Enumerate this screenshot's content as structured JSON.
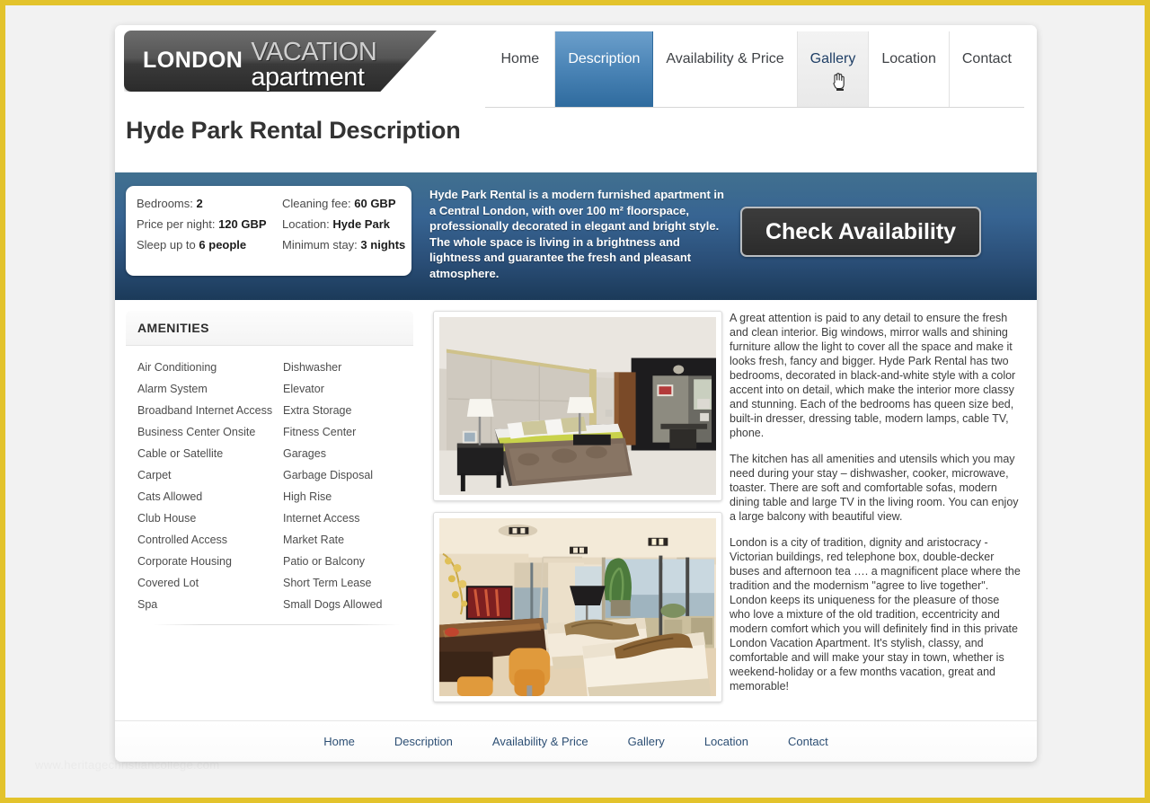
{
  "site": {
    "logo_primary": "LONDON",
    "logo_secondary": "VACATION",
    "logo_tertiary": "apartment"
  },
  "nav": {
    "items": [
      {
        "label": "Home",
        "state": "default"
      },
      {
        "label": "Description",
        "state": "active"
      },
      {
        "label": "Availability & Price",
        "state": "default"
      },
      {
        "label": "Gallery",
        "state": "hover"
      },
      {
        "label": "Location",
        "state": "default"
      },
      {
        "label": "Contact",
        "state": "default"
      }
    ]
  },
  "page": {
    "title": "Hyde Park Rental Description"
  },
  "facts": [
    {
      "label": "Bedrooms:",
      "value": "2"
    },
    {
      "label": "Cleaning fee:",
      "value": "60 GBP"
    },
    {
      "label": "Price per night:",
      "value": "120 GBP"
    },
    {
      "label": "Location:",
      "value": "Hyde Park"
    },
    {
      "label": "Sleep up to",
      "value": "6 people"
    },
    {
      "label": "Minimum stay:",
      "value": "3 nights"
    }
  ],
  "band": {
    "summary": "Hyde Park Rental is a modern furnished apartment in a Central London, with over 100 m² floorspace, professionally decorated in elegant and bright style. The whole space is living in a brightness and lightness and guarantee the fresh and pleasant atmosphere.",
    "cta_label": "Check Availability"
  },
  "amenities": {
    "heading": "AMENITIES",
    "left": [
      "Air Conditioning",
      "Alarm System",
      "Broadband Internet Access",
      "Business Center Onsite",
      "Cable or Satellite",
      "Carpet",
      "Cats Allowed",
      "Club House",
      "Controlled Access",
      "Corporate Housing",
      "Covered Lot",
      "Spa"
    ],
    "right": [
      "Dishwasher",
      "Elevator",
      "Extra Storage",
      "Fitness Center",
      "Garages",
      "Garbage Disposal",
      "High Rise",
      "Internet Access",
      "Market Rate",
      "Patio or Balcony",
      "Short Term Lease",
      "Small Dogs Allowed"
    ]
  },
  "photos": [
    {
      "alt": "bedroom-photo"
    },
    {
      "alt": "living-room-photo"
    }
  ],
  "description": {
    "paragraphs": [
      "A great attention is paid to any detail to ensure the fresh and clean interior. Big windows, mirror walls and shining furniture allow the light to cover all the space and make it looks fresh, fancy and bigger. Hyde Park Rental has two bedrooms, decorated in black-and-white style with a color accent into on detail, which make the interior more classy and stunning. Each of the bedrooms has queen size bed, built-in dresser, dressing table, modern lamps, cable TV, phone.",
      "The kitchen has all amenities and utensils which you may need during your stay – dishwasher, cooker, microwave, toaster. There are soft and comfortable sofas, modern dining table and large TV in the living room. You can enjoy a large balcony with beautiful view.",
      "London is a city of tradition, dignity and aristocracy - Victorian buildings, red telephone box, double-decker buses and afternoon tea …. a magnificent place where the tradition and the modernism \"agree to live together\". London keeps its uniqueness for the pleasure of those who love a mixture of the old tradition, eccentricity and modern comfort which you will definitely find in this private London Vacation Apartment. It's stylish, classy, and comfortable and will make your stay in town, whether is weekend-holiday or a few months vacation, great and memorable!"
    ]
  },
  "footer": {
    "links": [
      "Home",
      "Description",
      "Availability & Price",
      "Gallery",
      "Location",
      "Contact"
    ]
  },
  "watermark": "www.heritagechristiancollege.com",
  "colors": {
    "page_border": "#e3c32c",
    "nav_active": "#2f6b9e",
    "band_top": "#41708f",
    "band_bottom": "#1b3a59",
    "cta_bg": "#343434",
    "link": "#2d4f74"
  }
}
